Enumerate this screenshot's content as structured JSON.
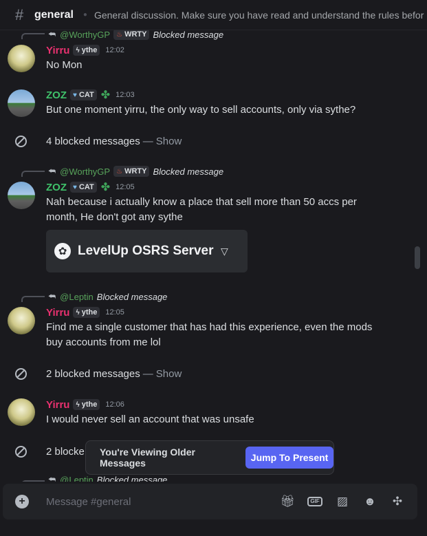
{
  "header": {
    "channel": "general",
    "topic": "General discussion. Make sure you have read and understand the rules before ..."
  },
  "messages": {
    "reply1": {
      "mention": "@WorthyGP",
      "tag": "WRTY",
      "blocked": "Blocked message"
    },
    "msg1": {
      "author": "Yirru",
      "tag": "ythe",
      "time": "12:02",
      "text": "No Mon"
    },
    "msg2": {
      "author": "ZOZ",
      "tag": "CAT",
      "time": "12:03",
      "text": "But one moment yirru, the only way to sell accounts, only via sythe?"
    },
    "blocked1": {
      "text": "4 blocked messages",
      "dash": "—",
      "show": "Show"
    },
    "reply2": {
      "mention": "@WorthyGP",
      "tag": "WRTY",
      "blocked": "Blocked message"
    },
    "msg3": {
      "author": "ZOZ",
      "tag": "CAT",
      "time": "12:05",
      "text": "Nah because i actually know a place that sell more than 50 accs per month, He don't got any sythe"
    },
    "embed": {
      "name": "LevelUp OSRS Server"
    },
    "reply3": {
      "mention": "@Leptin",
      "blocked": "Blocked message"
    },
    "msg4": {
      "author": "Yirru",
      "tag": "ythe",
      "time": "12:05",
      "text": "Find me a single customer that has had this experience, even the mods buy accounts from me lol"
    },
    "blocked2": {
      "text": "2 blocked messages",
      "dash": "—",
      "show": "Show"
    },
    "msg5": {
      "author": "Yirru",
      "tag": "ythe",
      "time": "12:06",
      "text": "I would never sell an account that was unsafe"
    },
    "blocked3": {
      "text": "2 blocke"
    },
    "reply4": {
      "mention": "@Leptin",
      "blocked": "Blocked message"
    }
  },
  "jump_bar": {
    "viewing": "You're Viewing Older Messages",
    "button": "Jump To Present"
  },
  "composer": {
    "placeholder": "Message #general",
    "gif": "GIF"
  },
  "colors": {
    "yirru": "#e8316f",
    "zoz": "#3fc16a",
    "mention_green": "#58a35b",
    "jump_button": "#5865f2"
  }
}
